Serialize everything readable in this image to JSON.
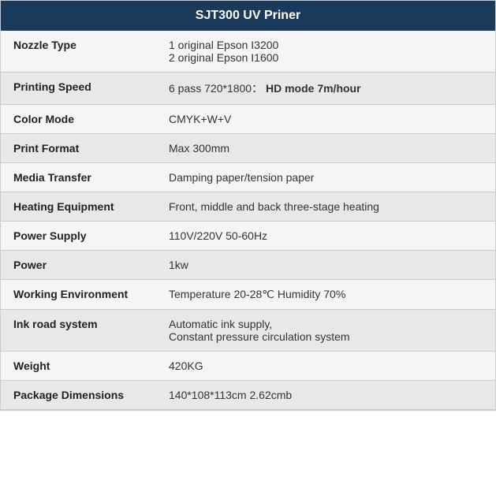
{
  "header": {
    "title": "SJT300 UV Priner"
  },
  "rows": [
    {
      "label": "Nozzle Type",
      "value": "1 original Epson I3200\n2 original Epson I1600",
      "html": "1 original Epson I3200<br>2 original Epson I1600"
    },
    {
      "label": "Printing Speed",
      "value": "6 pass 720*1800： HD mode 7m/hour",
      "html": "6 pass 720*1800：<span class=\"bold-part\"> HD mode 7m/hour</span>"
    },
    {
      "label": "Color Mode",
      "value": "CMYK+W+V",
      "html": "CMYK+W+V"
    },
    {
      "label": "Print Format",
      "value": "Max 300mm",
      "html": "Max 300mm"
    },
    {
      "label": "Media Transfer",
      "value": "Damping paper/tension paper",
      "html": "Damping paper/tension paper"
    },
    {
      "label": "Heating Equipment",
      "value": "Front, middle and back three-stage heating",
      "html": "Front, middle and back three-stage heating"
    },
    {
      "label": "Power Supply",
      "value": "110V/220V 50-60Hz",
      "html": "110V/220V 50-60Hz"
    },
    {
      "label": "Power",
      "value": "1kw",
      "html": "1kw"
    },
    {
      "label": "Working Environment",
      "value": "Temperature 20-28℃ Humidity 70%",
      "html": "Temperature 20-28℃ Humidity 70%"
    },
    {
      "label": "Ink road system",
      "value": "Automatic ink supply,\nConstant pressure circulation system",
      "html": "Automatic ink supply,<br>Constant pressure circulation system"
    },
    {
      "label": "Weight",
      "value": "420KG",
      "html": "420KG"
    },
    {
      "label": "Package Dimensions",
      "value": "140*108*113cm 2.62cmb",
      "html": "140*108*113cm 2.62cmb"
    }
  ]
}
